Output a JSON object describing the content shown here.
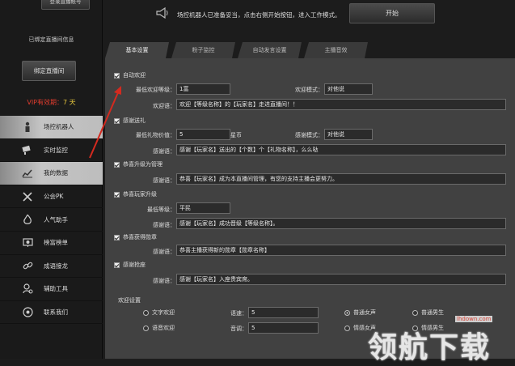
{
  "sidebar": {
    "top_button": "登录直播帐号",
    "bound_info": "已绑定直播间信息",
    "bind_button": "绑定直播间",
    "vip_label": "VIP有效期：",
    "vip_days": "7 天",
    "items": [
      {
        "label": "场控机器人",
        "icon": "robot-icon",
        "active": true
      },
      {
        "label": "实时监控",
        "icon": "camera-icon",
        "active": false
      },
      {
        "label": "我的数据",
        "icon": "chart-icon",
        "active": true
      },
      {
        "label": "公会PK",
        "icon": "swords-icon",
        "active": false
      },
      {
        "label": "人气助手",
        "icon": "fire-icon",
        "active": false
      },
      {
        "label": "榜富榜单",
        "icon": "trophy-board-icon",
        "active": false
      },
      {
        "label": "成语接龙",
        "icon": "chain-link-icon",
        "active": false
      },
      {
        "label": "辅助工具",
        "icon": "tools-icon",
        "active": false
      },
      {
        "label": "联系我们",
        "icon": "headset-icon",
        "active": false
      }
    ]
  },
  "header": {
    "notice": "场控机器人已准备妥当，点击右侧开始按钮，进入工作模式。",
    "start_button": "开始"
  },
  "tabs": [
    "基本设置",
    "粉子监控",
    "自动发言设置",
    "主播音效"
  ],
  "welcome": {
    "checkbox_label": "自动欢迎",
    "min_level_label": "最低欢迎等级：",
    "min_level_value": "1富",
    "reply_mode_label": "欢迎模式：",
    "reply_mode_value": "对他说",
    "phrase_label": "欢迎语：",
    "phrase_value": "欢迎【等级名称】的【玩家名】走进直播间！！"
  },
  "gift": {
    "checkbox_label": "感谢送礼",
    "min_value_label": "最低礼物价值：",
    "min_value": "5",
    "unit": "星币",
    "thanks_mode_label": "感谢模式：",
    "thanks_mode_value": "对他说",
    "phrase_label": "感谢语：",
    "phrase_value": "感谢【玩家名】送出的【个数】个【礼物名称】，么么哒"
  },
  "admin": {
    "checkbox_label": "恭喜升级为管理",
    "phrase_label": "感谢语：",
    "phrase_value": "恭喜【玩家名】成为本直播间管理，有您的支持主播会更努力。"
  },
  "levelup": {
    "checkbox_label": "恭喜玩家升级",
    "min_level_label": "最低等级：",
    "min_level_value": "平民",
    "phrase_label": "感谢语：",
    "phrase_value": "感谢【玩家名】成功晋级【等级名称】。"
  },
  "medal": {
    "checkbox_label": "恭喜获得勋章",
    "phrase_label": "感谢语：",
    "phrase_value": "恭喜主播获得新的勋章【勋章名称】"
  },
  "guard": {
    "checkbox_label": "感谢抢座",
    "phrase_label": "感谢语：",
    "phrase_value": "感谢【玩家名】入座贵宾席。"
  },
  "voice": {
    "section_label": "欢迎设置",
    "text_welcome": "文字欢迎",
    "voice_welcome": "语音欢迎",
    "speed_label": "语速：",
    "speed_value": "5",
    "pitch_label": "音调：",
    "pitch_value": "5",
    "opt1": "普通女声",
    "opt2": "普通男生",
    "opt3": "情感女声",
    "opt4": "情感男生"
  },
  "watermark": {
    "url": "lhdown.com",
    "text": "领航下载"
  },
  "colors": {
    "vip_label": "#e23c2e",
    "vip_days": "#e2c23c",
    "arrow": "#d42a1f",
    "panel_bg": "#414141"
  }
}
